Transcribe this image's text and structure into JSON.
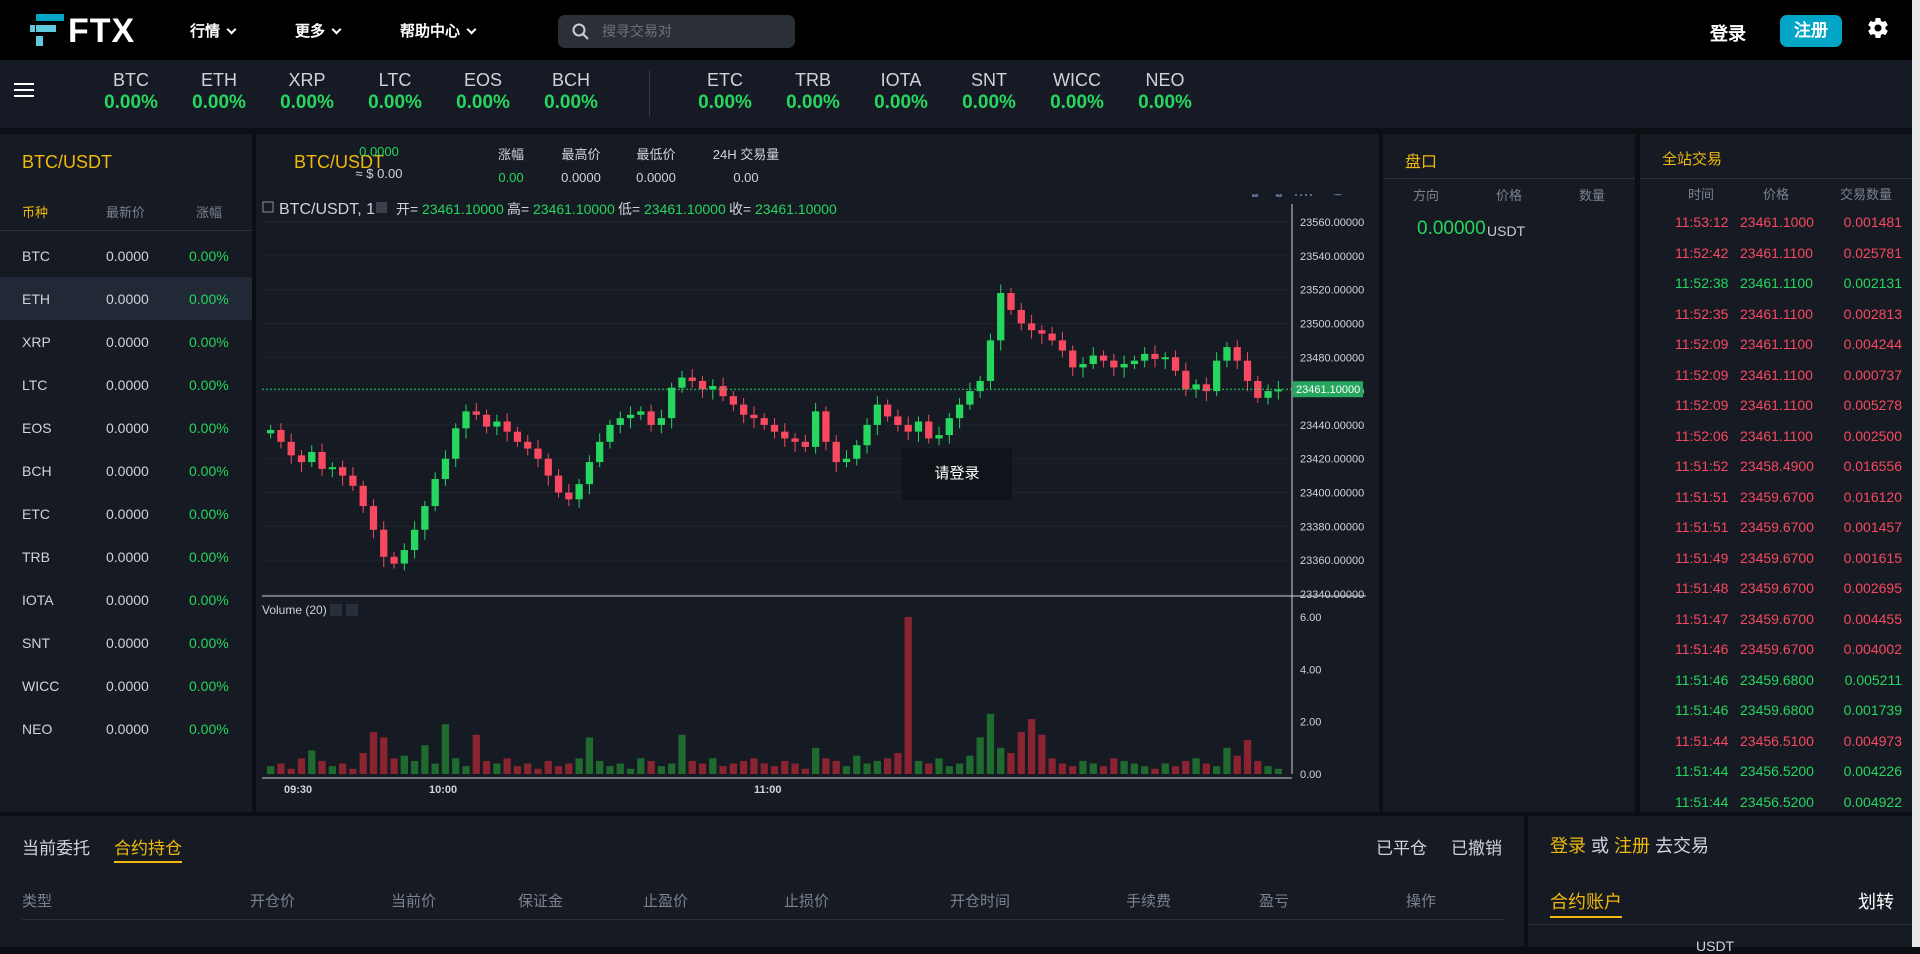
{
  "topnav": {
    "logo": "FTX",
    "menus": [
      "行情",
      "更多",
      "帮助中心"
    ],
    "search_placeholder": "搜寻交易对",
    "login": "登录",
    "register": "注册"
  },
  "ticker_group1": [
    {
      "sym": "BTC",
      "pct": "0.00%"
    },
    {
      "sym": "ETH",
      "pct": "0.00%"
    },
    {
      "sym": "XRP",
      "pct": "0.00%"
    },
    {
      "sym": "LTC",
      "pct": "0.00%"
    },
    {
      "sym": "EOS",
      "pct": "0.00%"
    },
    {
      "sym": "BCH",
      "pct": "0.00%"
    }
  ],
  "ticker_group2": [
    {
      "sym": "ETC",
      "pct": "0.00%"
    },
    {
      "sym": "TRB",
      "pct": "0.00%"
    },
    {
      "sym": "IOTA",
      "pct": "0.00%"
    },
    {
      "sym": "SNT",
      "pct": "0.00%"
    },
    {
      "sym": "WICC",
      "pct": "0.00%"
    },
    {
      "sym": "NEO",
      "pct": "0.00%"
    }
  ],
  "market_list": {
    "title": "BTC/USDT",
    "headers": [
      "币种",
      "最新价",
      "涨幅"
    ],
    "rows": [
      {
        "coin": "BTC",
        "price": "0.0000",
        "change": "0.00%"
      },
      {
        "coin": "ETH",
        "price": "0.0000",
        "change": "0.00%"
      },
      {
        "coin": "XRP",
        "price": "0.0000",
        "change": "0.00%"
      },
      {
        "coin": "LTC",
        "price": "0.0000",
        "change": "0.00%"
      },
      {
        "coin": "EOS",
        "price": "0.0000",
        "change": "0.00%"
      },
      {
        "coin": "BCH",
        "price": "0.0000",
        "change": "0.00%"
      },
      {
        "coin": "ETC",
        "price": "0.0000",
        "change": "0.00%"
      },
      {
        "coin": "TRB",
        "price": "0.0000",
        "change": "0.00%"
      },
      {
        "coin": "IOTA",
        "price": "0.0000",
        "change": "0.00%"
      },
      {
        "coin": "SNT",
        "price": "0.0000",
        "change": "0.00%"
      },
      {
        "coin": "WICC",
        "price": "0.0000",
        "change": "0.00%"
      },
      {
        "coin": "NEO",
        "price": "0.0000",
        "change": "0.00%"
      }
    ]
  },
  "chart_header": {
    "pair": "BTC/USDT",
    "last_price": "0.0000",
    "usd_value": "≈ $ 0.00",
    "change_label": "涨幅",
    "change_value": "0.00",
    "high_label": "最高价",
    "high_value": "0.0000",
    "low_label": "最低价",
    "low_value": "0.0000",
    "vol_label": "24H 交易量",
    "vol_value": "0.00"
  },
  "chart_data": {
    "type": "candlestick",
    "title": "BTC/USDT, 1",
    "legend": {
      "open_label": "开=",
      "open": "23461.10000",
      "high_label": "高=",
      "high": "23461.10000",
      "low_label": "低=",
      "low": "23461.10000",
      "close_label": "收=",
      "close": "23461.10000"
    },
    "price_ticks": [
      "23560.00000",
      "23540.00000",
      "23520.00000",
      "23500.00000",
      "23480.00000",
      "23460.00000",
      "23440.00000",
      "23420.00000",
      "23400.00000",
      "23380.00000",
      "23360.00000",
      "23340.00000"
    ],
    "last_price_label": "23461.10000",
    "ylim": [
      23340,
      23560
    ],
    "volume_label": "Volume (20)",
    "volume_ticks": [
      "6.00",
      "4.00",
      "2.00",
      "0.00"
    ],
    "volume_ylim": [
      0,
      6
    ],
    "time_ticks": [
      "09:30",
      "10:00",
      "11:00"
    ],
    "close_series": [
      23437,
      23430,
      23422,
      23418,
      23424,
      23414,
      23415,
      23410,
      23404,
      23392,
      23378,
      23362,
      23358,
      23366,
      23378,
      23392,
      23408,
      23420,
      23438,
      23448,
      23446,
      23439,
      23442,
      23436,
      23430,
      23426,
      23420,
      23410,
      23400,
      23396,
      23405,
      23418,
      23430,
      23440,
      23444,
      23446,
      23448,
      23440,
      23444,
      23462,
      23468,
      23466,
      23461,
      23463,
      23457,
      23452,
      23446,
      23444,
      23440,
      23436,
      23432,
      23430,
      23427,
      23448,
      23430,
      23418,
      23420,
      23428,
      23440,
      23452,
      23445,
      23440,
      23436,
      23442,
      23432,
      23434,
      23444,
      23452,
      23460,
      23466,
      23490,
      23518,
      23508,
      23500,
      23496,
      23494,
      23490,
      23484,
      23474,
      23476,
      23481,
      23478,
      23474,
      23476,
      23478,
      23482,
      23479,
      23480,
      23472,
      23461,
      23464,
      23460,
      23478,
      23486,
      23478,
      23466,
      23456,
      23460,
      23461
    ],
    "volume_series": [
      0.3,
      0.4,
      0.2,
      0.6,
      0.9,
      0.5,
      0.3,
      0.4,
      0.2,
      0.8,
      1.6,
      1.4,
      0.6,
      0.7,
      0.5,
      1.1,
      0.4,
      1.9,
      0.6,
      0.3,
      1.5,
      0.5,
      0.4,
      0.6,
      0.3,
      0.4,
      0.2,
      0.5,
      0.3,
      0.4,
      0.6,
      1.4,
      0.5,
      0.3,
      0.4,
      0.2,
      0.6,
      0.5,
      0.3,
      0.4,
      1.5,
      0.5,
      0.4,
      0.6,
      0.3,
      0.4,
      0.5,
      0.6,
      0.4,
      0.3,
      0.5,
      0.4,
      0.2,
      1.0,
      0.6,
      0.5,
      0.3,
      0.7,
      0.4,
      0.5,
      0.6,
      0.8,
      6.0,
      0.5,
      0.4,
      0.6,
      0.3,
      0.4,
      0.7,
      1.4,
      2.3,
      1.0,
      0.8,
      1.6,
      2.1,
      1.5,
      0.6,
      0.4,
      0.3,
      0.5,
      0.4,
      0.3,
      0.6,
      0.5,
      0.4,
      0.3,
      0.2,
      0.4,
      0.3,
      0.5,
      0.6,
      0.4,
      0.3,
      1.0,
      0.7,
      1.3,
      0.5,
      0.3,
      0.2
    ]
  },
  "login_tip": "请登录",
  "orderbook": {
    "title": "盘口",
    "headers": [
      "方向",
      "价格",
      "数量"
    ],
    "value": "0.00000",
    "unit": "USDT"
  },
  "trades": {
    "title": "全站交易",
    "headers": [
      "时间",
      "价格",
      "交易数量"
    ],
    "rows": [
      {
        "time": "11:53:12",
        "price": "23461.1000",
        "qty": "0.001481",
        "side": "sell"
      },
      {
        "time": "11:52:42",
        "price": "23461.1100",
        "qty": "0.025781",
        "side": "sell"
      },
      {
        "time": "11:52:38",
        "price": "23461.1100",
        "qty": "0.002131",
        "side": "buy"
      },
      {
        "time": "11:52:35",
        "price": "23461.1100",
        "qty": "0.002813",
        "side": "sell"
      },
      {
        "time": "11:52:09",
        "price": "23461.1100",
        "qty": "0.004244",
        "side": "sell"
      },
      {
        "time": "11:52:09",
        "price": "23461.1100",
        "qty": "0.000737",
        "side": "sell"
      },
      {
        "time": "11:52:09",
        "price": "23461.1100",
        "qty": "0.005278",
        "side": "sell"
      },
      {
        "time": "11:52:06",
        "price": "23461.1100",
        "qty": "0.002500",
        "side": "sell"
      },
      {
        "time": "11:51:52",
        "price": "23458.4900",
        "qty": "0.016556",
        "side": "sell"
      },
      {
        "time": "11:51:51",
        "price": "23459.6700",
        "qty": "0.016120",
        "side": "sell"
      },
      {
        "time": "11:51:51",
        "price": "23459.6700",
        "qty": "0.001457",
        "side": "sell"
      },
      {
        "time": "11:51:49",
        "price": "23459.6700",
        "qty": "0.001615",
        "side": "sell"
      },
      {
        "time": "11:51:48",
        "price": "23459.6700",
        "qty": "0.002695",
        "side": "sell"
      },
      {
        "time": "11:51:47",
        "price": "23459.6700",
        "qty": "0.004455",
        "side": "sell"
      },
      {
        "time": "11:51:46",
        "price": "23459.6700",
        "qty": "0.004002",
        "side": "sell"
      },
      {
        "time": "11:51:46",
        "price": "23459.6800",
        "qty": "0.005211",
        "side": "buy"
      },
      {
        "time": "11:51:46",
        "price": "23459.6800",
        "qty": "0.001739",
        "side": "buy"
      },
      {
        "time": "11:51:44",
        "price": "23456.5100",
        "qty": "0.004973",
        "side": "sell"
      },
      {
        "time": "11:51:44",
        "price": "23456.5200",
        "qty": "0.004226",
        "side": "buy"
      },
      {
        "time": "11:51:44",
        "price": "23456.5200",
        "qty": "0.004922",
        "side": "buy"
      }
    ]
  },
  "positions": {
    "tab_current": "当前委托",
    "tab_contract": "合约持仓",
    "closed": "已平仓",
    "cancelled": "已撤销",
    "columns": [
      "类型",
      "开仓价",
      "当前价",
      "保证金",
      "止盈价",
      "止损价",
      "开仓时间",
      "手续费",
      "盈亏",
      "操作"
    ]
  },
  "account": {
    "login": "登录",
    "or": "或",
    "register": "注册",
    "to_trade": "去交易",
    "tab": "合约账户",
    "transfer": "划转",
    "usdt": "USDT"
  },
  "colors": {
    "accent": "#f0b90b",
    "up": "#26d65e",
    "down": "#f84960",
    "brand": "#02a5c5"
  }
}
